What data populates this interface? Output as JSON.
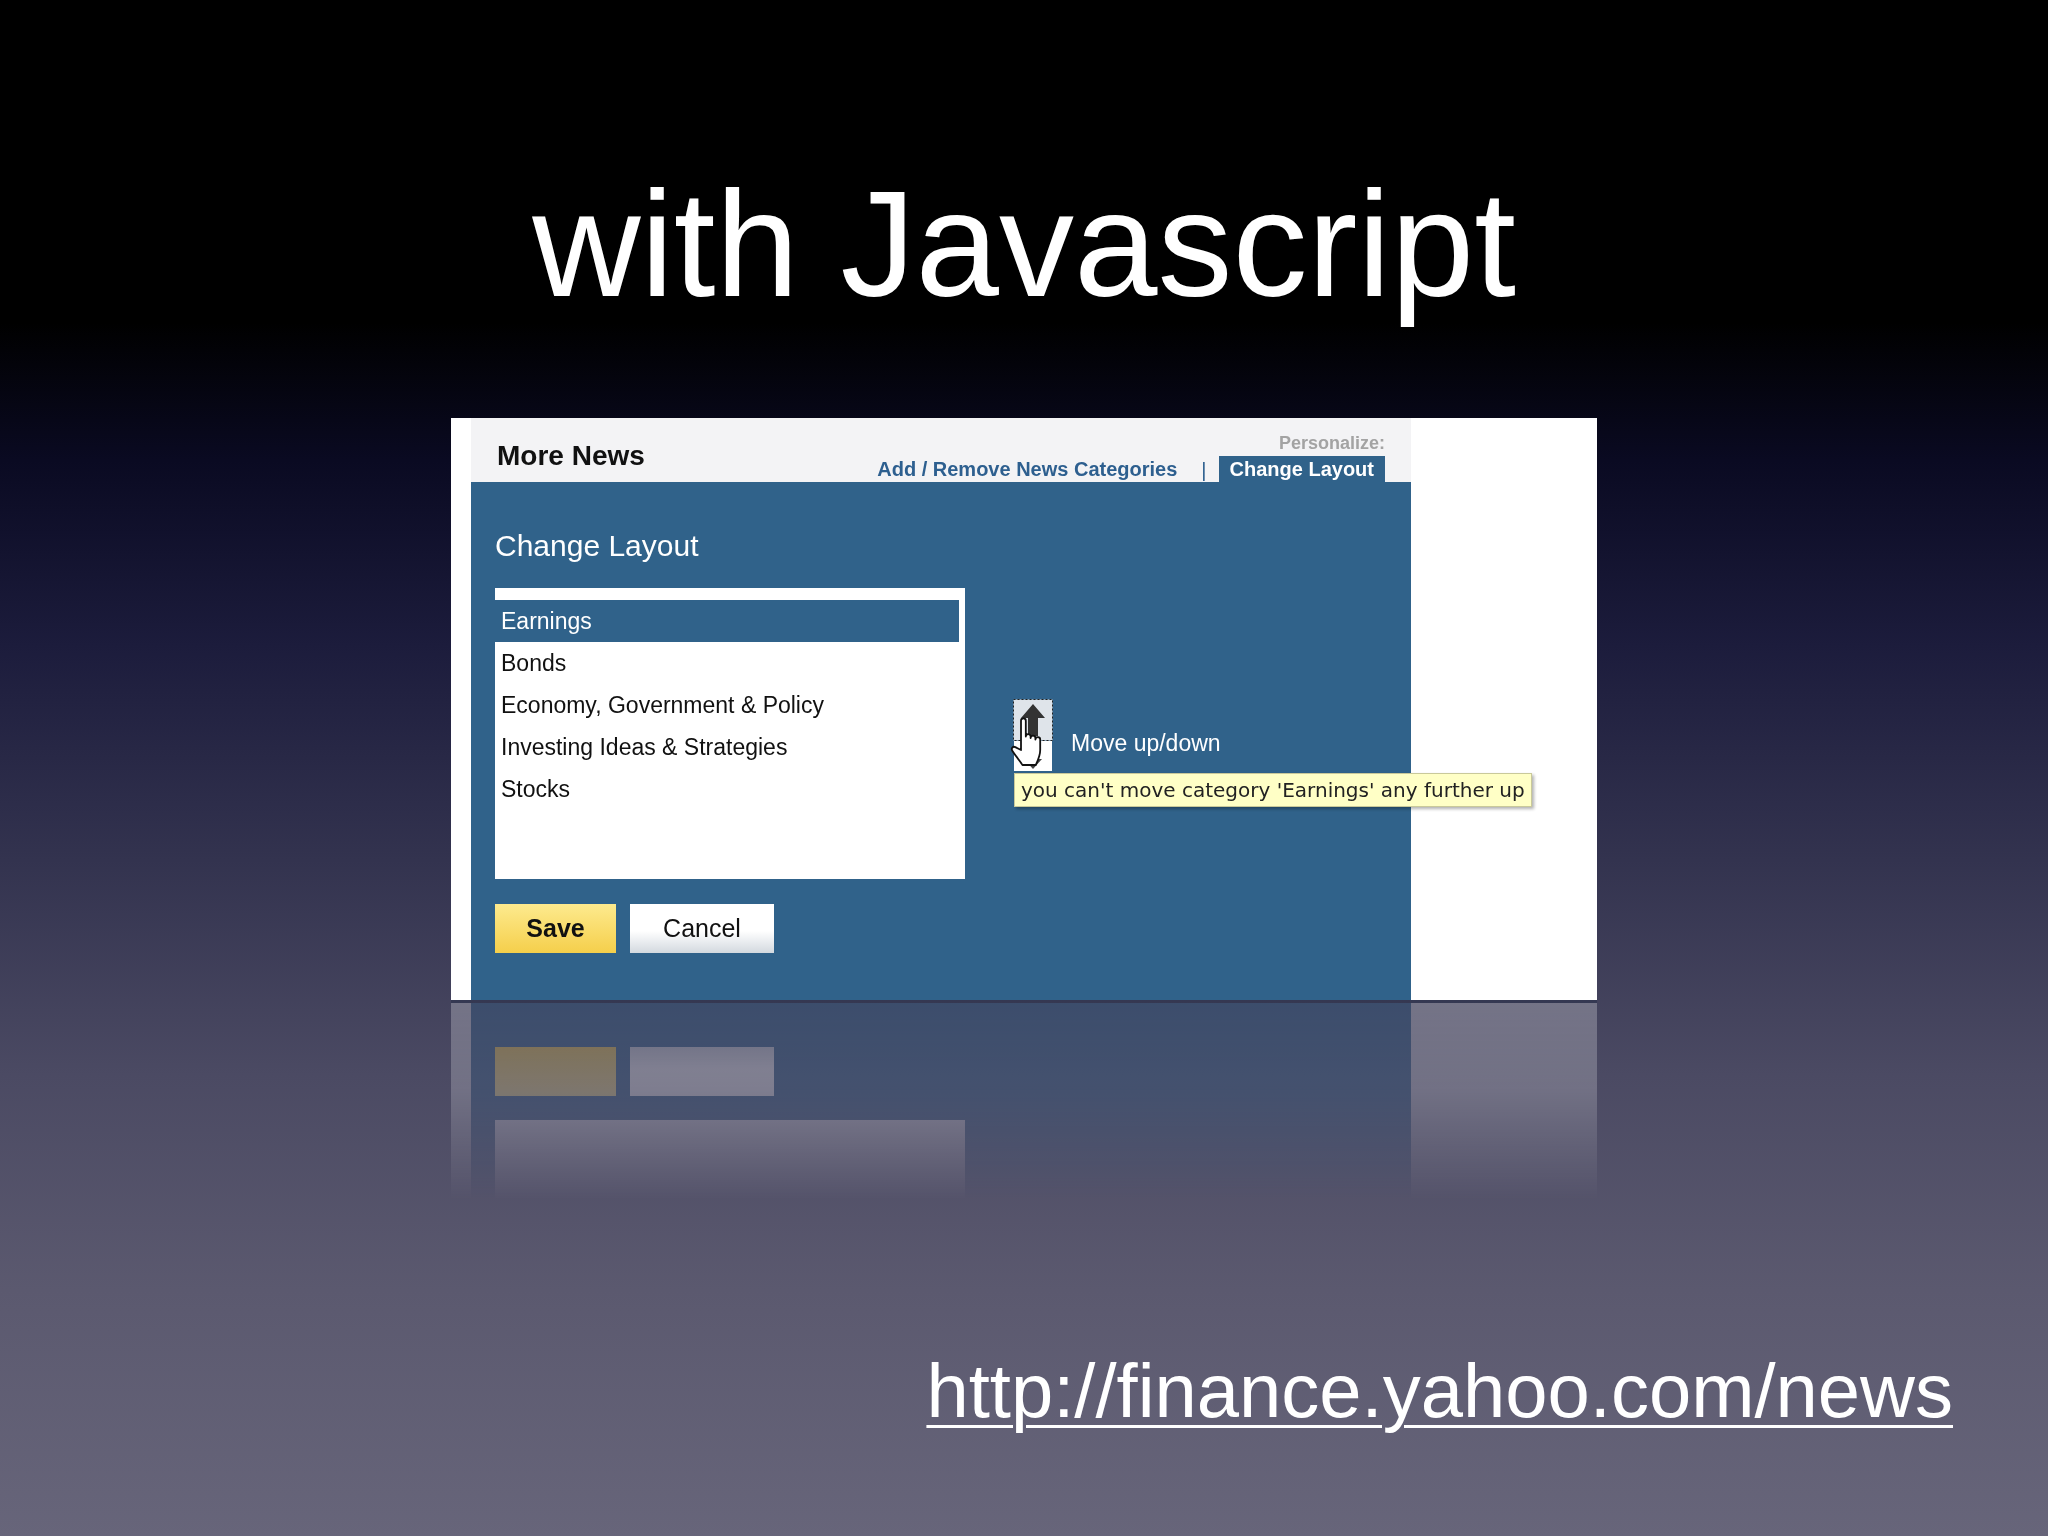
{
  "slide": {
    "title": "with Javascript"
  },
  "screenshot": {
    "header": {
      "title": "More News",
      "personalize_label": "Personalize:",
      "separator": "|",
      "links": [
        {
          "label": "Add / Remove News Categories",
          "selected": false
        },
        {
          "label": "Change Layout",
          "selected": true
        }
      ]
    },
    "panel": {
      "heading": "Change Layout",
      "categories": [
        {
          "label": "Earnings",
          "selected": true
        },
        {
          "label": "Bonds",
          "selected": false
        },
        {
          "label": "Economy, Government & Policy",
          "selected": false
        },
        {
          "label": "Investing Ideas & Strategies",
          "selected": false
        },
        {
          "label": "Stocks",
          "selected": false
        }
      ],
      "move_control": {
        "label": "Move up/down",
        "tooltip": "you can't move category 'Earnings' any further up"
      },
      "buttons": [
        {
          "label": "Save",
          "kind": "primary"
        },
        {
          "label": "Cancel",
          "kind": "secondary"
        }
      ]
    }
  },
  "url": "http://finance.yahoo.com/news"
}
